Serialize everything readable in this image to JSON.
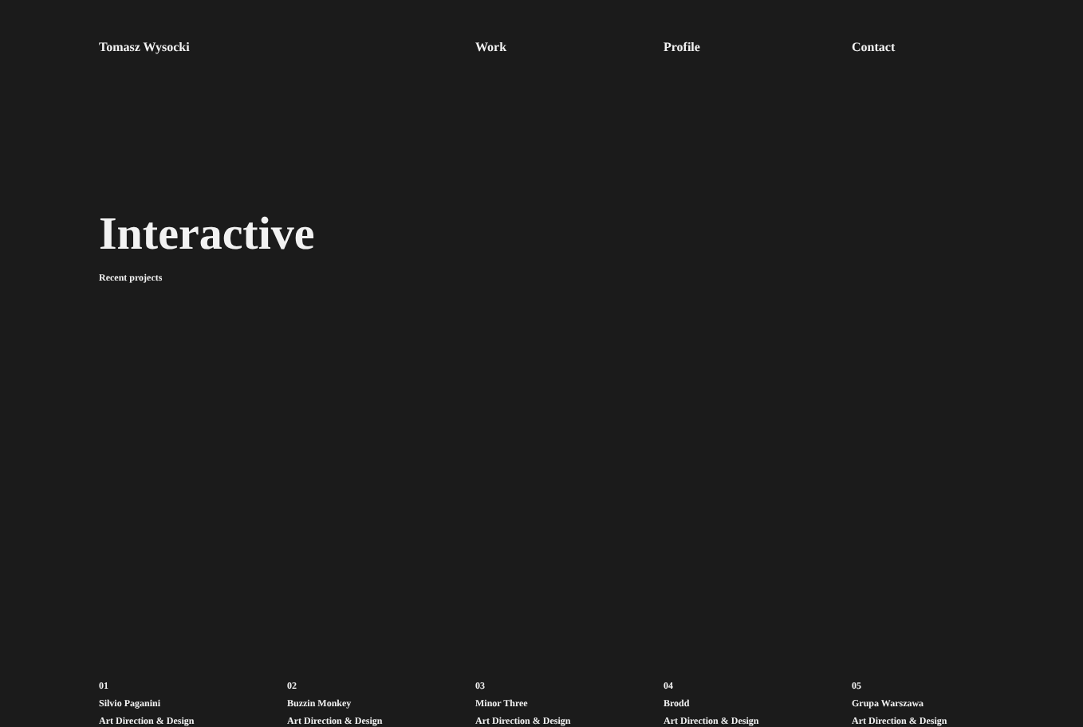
{
  "header": {
    "name": "Tomasz Wysocki",
    "nav": [
      {
        "label": "Work"
      },
      {
        "label": "Profile"
      },
      {
        "label": "Contact"
      }
    ]
  },
  "hero": {
    "title": "Interactive",
    "subtitle": "Recent projects"
  },
  "projects": [
    {
      "number": "01",
      "title": "Silvio Paganini",
      "role": "Art Direction & Design"
    },
    {
      "number": "02",
      "title": "Buzzin Monkey",
      "role": "Art Direction & Design"
    },
    {
      "number": "03",
      "title": "Minor Three",
      "role": "Art Direction & Design"
    },
    {
      "number": "04",
      "title": "Brodd",
      "role": "Art Direction & Design"
    },
    {
      "number": "05",
      "title": "Grupa Warszawa",
      "role": "Art Direction & Design"
    }
  ]
}
